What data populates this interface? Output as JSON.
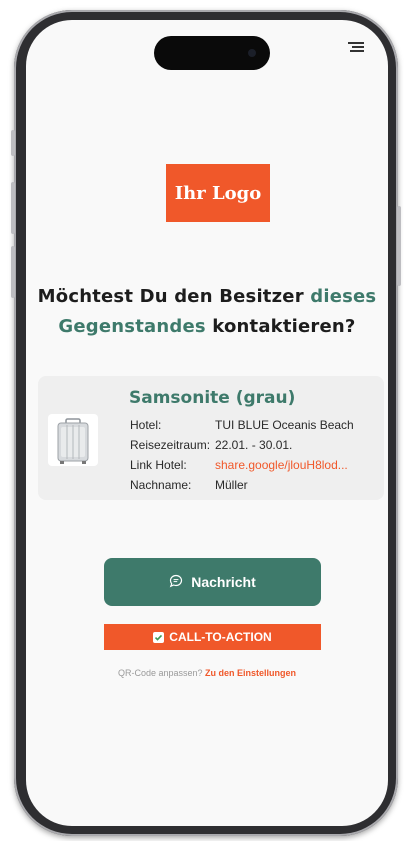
{
  "logo": {
    "text": "Ihr Logo"
  },
  "headline": {
    "part1": "Möchtest Du den Besitzer ",
    "accent1": "dieses",
    "accent2": "Gegenstandes",
    "part2": " kontaktieren?"
  },
  "item": {
    "title": "Samsonite (grau)",
    "details": [
      {
        "label": "Hotel:",
        "value": "TUI BLUE Oceanis Beach"
      },
      {
        "label": "Reisezeitraum:",
        "value": "22.01. - 30.01."
      },
      {
        "label": "Link Hotel:",
        "value": "share.google/jlouH8lod..."
      },
      {
        "label": "Nachname:",
        "value": "Müller"
      }
    ]
  },
  "buttons": {
    "message_label": "Nachricht",
    "cta_label": "CALL-TO-ACTION"
  },
  "footer": {
    "text": "QR-Code anpassen?",
    "link": "Zu den Einstellungen"
  },
  "colors": {
    "accent_green": "#3e7a6b",
    "accent_orange": "#f0582a"
  },
  "icons": [
    "menu-icon",
    "suitcase-icon",
    "chat-bubble-icon",
    "checkbox-icon"
  ]
}
